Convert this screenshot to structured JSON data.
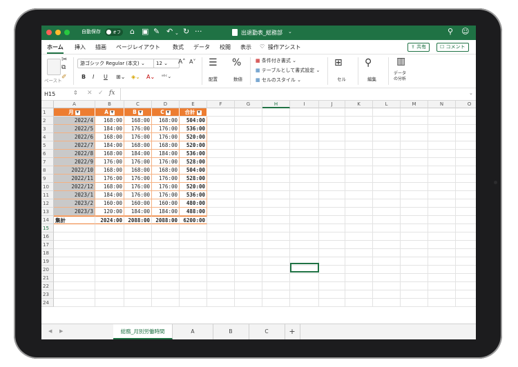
{
  "titlebar": {
    "autosave": "自動保存",
    "autosave_state": "オフ",
    "filename": "出退勤表_総務部",
    "colors": {
      "bg": "#1f7244"
    }
  },
  "menu": {
    "tabs": [
      "ホーム",
      "挿入",
      "描画",
      "ページレイアウト",
      "数式",
      "データ",
      "校閲",
      "表示"
    ],
    "assist": "操作アシスト",
    "share": "共有",
    "comment": "コメント"
  },
  "ribbon": {
    "paste": "ペースト",
    "font_name": "游ゴシック Regular (本文)",
    "font_size": "12",
    "bold": "B",
    "italic": "I",
    "underline": "U",
    "align": "配置",
    "number": "数値",
    "number_icon": "%",
    "cond_format": "条件付き書式",
    "table_format": "テーブルとして書式設定",
    "cell_style": "セルのスタイル",
    "cells": "セル",
    "edit": "編集",
    "analysis": "データ\nの分析"
  },
  "formula_bar": {
    "name_box": "H15",
    "fx": "fx",
    "value": ""
  },
  "sheet": {
    "columns": [
      "A",
      "B",
      "C",
      "D",
      "E",
      "F",
      "G",
      "H",
      "I",
      "J",
      "K",
      "L",
      "M",
      "N",
      "O"
    ],
    "row_numbers": [
      "1",
      "2",
      "3",
      "4",
      "5",
      "6",
      "7",
      "8",
      "9",
      "10",
      "11",
      "12",
      "13",
      "14",
      "15",
      "16",
      "17",
      "18",
      "19",
      "20",
      "21",
      "22",
      "23",
      "24"
    ],
    "headers": [
      "月",
      "A",
      "B",
      "C",
      "合計"
    ],
    "rows": [
      [
        "2022/4",
        "168:00",
        "168:00",
        "168:00",
        "504:00"
      ],
      [
        "2022/5",
        "184:00",
        "176:00",
        "176:00",
        "536:00"
      ],
      [
        "2022/6",
        "168:00",
        "176:00",
        "176:00",
        "520:00"
      ],
      [
        "2022/7",
        "184:00",
        "168:00",
        "168:00",
        "520:00"
      ],
      [
        "2022/8",
        "168:00",
        "184:00",
        "184:00",
        "536:00"
      ],
      [
        "2022/9",
        "176:00",
        "176:00",
        "176:00",
        "528:00"
      ],
      [
        "2022/10",
        "168:00",
        "168:00",
        "168:00",
        "504:00"
      ],
      [
        "2022/11",
        "176:00",
        "176:00",
        "176:00",
        "528:00"
      ],
      [
        "2022/12",
        "168:00",
        "176:00",
        "176:00",
        "520:00"
      ],
      [
        "2023/1",
        "184:00",
        "176:00",
        "176:00",
        "536:00"
      ],
      [
        "2023/2",
        "160:00",
        "160:00",
        "160:00",
        "480:00"
      ],
      [
        "2023/3",
        "120:00",
        "184:00",
        "184:00",
        "488:00"
      ]
    ],
    "total": [
      "集計",
      "2024:00",
      "2088:00",
      "2088:00",
      "6200:00"
    ],
    "selected_cell": "H15",
    "header_color": "#ed7d31"
  },
  "tabs": {
    "sheets": [
      "総務_月別労働時間",
      "A",
      "B",
      "C"
    ],
    "add": "+"
  }
}
